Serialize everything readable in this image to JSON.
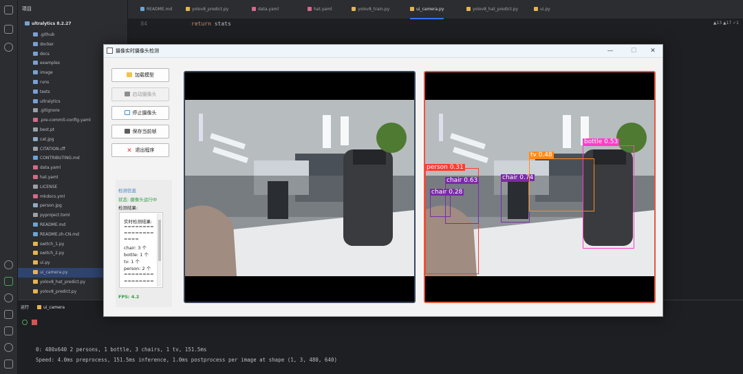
{
  "ide": {
    "project_menu": "项目",
    "root": "ultralytics 8.2.27",
    "tree": [
      ".github",
      "docker",
      "docs",
      "examples",
      "image",
      "runs",
      "tests",
      "ultralytics",
      ".gitignore",
      ".pre-commit-config.yaml",
      "best.pt",
      "cat.jpg",
      "CITATION.cff",
      "CONTRIBUTING.md",
      "data.yaml",
      "hat.yaml",
      "LICENSE",
      "mkdocs.yml",
      "person.jpg",
      "pyproject.toml",
      "README.md",
      "README.zh-CN.md",
      "switch_1.py",
      "switch_2.py",
      "ui.py",
      "ui_camera.py",
      "yolov8_hat_predict.py",
      "yolov8_predict.py"
    ],
    "tabs": [
      "README.md",
      "yolov8_predict.py",
      "data.yaml",
      "hat.yaml",
      "yolov8_train.py",
      "ui_camera.py",
      "yolov8_hat_predict.py",
      "ui.py"
    ],
    "code_line_number": "84",
    "code_keyword": "return",
    "code_rest": " stats",
    "inspections": "▲13  ▲17  ✓1",
    "run_label": "运行",
    "run_config": "ui_camera",
    "output_lines": [
      "0: 480x640 2 persons, 1 bottle, 3 chairs, 1 tv, 151.5ms",
      "Speed: 4.0ms preprocess, 151.5ms inference, 1.0ms postprocess per image at shape (1, 3, 480, 640)"
    ]
  },
  "window": {
    "title": "摄像实时摄像头检测",
    "buttons": [
      {
        "label": "加载模型",
        "icon": "folder-icon",
        "disabled": false
      },
      {
        "label": "启动摄像头",
        "icon": "camera-icon",
        "disabled": true
      },
      {
        "label": "停止摄像头",
        "icon": "stop-icon",
        "disabled": false
      },
      {
        "label": "保存当前帧",
        "icon": "save-icon",
        "disabled": false
      },
      {
        "label": "退出程序",
        "icon": "close-icon",
        "disabled": false
      }
    ],
    "info": {
      "title": "检测信息",
      "status": "状态: 摄像头运行中",
      "results_label": "检测结果:",
      "results_lines": [
        "实时检测结果:",
        "========",
        "========",
        "====",
        "chair: 3 个",
        "bottle: 1 个",
        "tv: 1 个",
        "person: 2 个",
        "========",
        "========"
      ],
      "fps": "FPS: 4.2"
    },
    "detections": [
      {
        "label": "person 0.31",
        "color": "#ff3b30"
      },
      {
        "label": "chair 0.63",
        "color": "#7b2aa8"
      },
      {
        "label": "chair 0.28",
        "color": "#7b2aa8"
      },
      {
        "label": "chair 0.74",
        "color": "#7b2aa8"
      },
      {
        "label": "tv 0.48",
        "color": "#ff8c1a"
      },
      {
        "label": "bottle 0.53",
        "color": "#ff3dc8"
      }
    ]
  }
}
